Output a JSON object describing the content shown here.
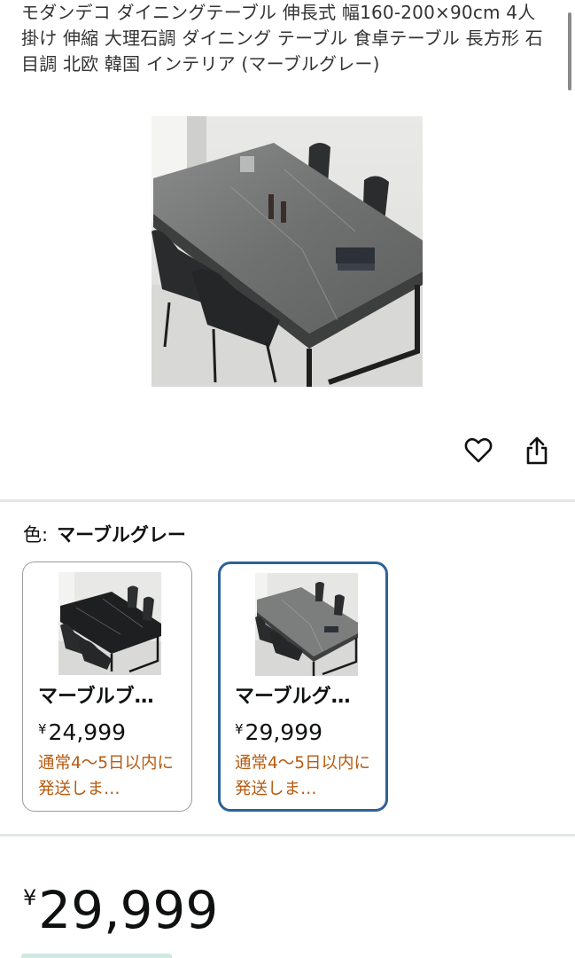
{
  "product": {
    "title": "モダンデコ ダイニングテーブル 伸長式 幅160-200×90cm 4人掛け 伸縮 大理石調 ダイニング テーブル 食卓テーブル 長方形 石目調 北欧 韓国 インテリア (マーブルグレー)"
  },
  "actions": {
    "favorite_icon": "heart-icon",
    "share_icon": "share-icon"
  },
  "color_selector": {
    "label": "色:",
    "selected_value": "マーブルグレー"
  },
  "variants": [
    {
      "name": "マーブルブ…",
      "currency": "¥",
      "price": "24,999",
      "shipping": "通常4〜5日以内に発送しま…",
      "selected": false
    },
    {
      "name": "マーブルグ…",
      "currency": "¥",
      "price": "29,999",
      "shipping": "通常4〜5日以内に発送しま…",
      "selected": true
    }
  ],
  "price": {
    "currency": "¥",
    "amount": "29,999"
  },
  "colors": {
    "selected_border": "#2d6296",
    "shipping_text": "#b75a0f"
  }
}
